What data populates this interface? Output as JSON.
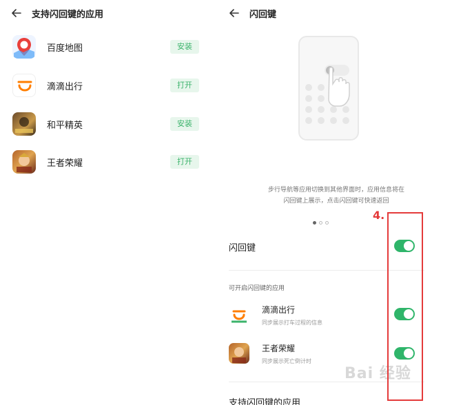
{
  "left": {
    "title": "支持闪回键的应用",
    "apps": [
      {
        "name": "百度地图",
        "action": "安装",
        "icon": "baidu-map-icon"
      },
      {
        "name": "滴滴出行",
        "action": "打开",
        "icon": "didi-icon"
      },
      {
        "name": "和平精英",
        "action": "安装",
        "icon": "peace-elite-icon"
      },
      {
        "name": "王者荣耀",
        "action": "打开",
        "icon": "honor-of-kings-icon"
      }
    ]
  },
  "right": {
    "title": "闪回键",
    "description_line1": "步行导航等应用切换到其他界面时，应用信息将在",
    "description_line2": "闪回键上展示，点击闪回键可快速返回",
    "main_toggle_label": "闪回键",
    "main_toggle_on": true,
    "section_title": "可开启闪回键的应用",
    "apps": [
      {
        "name": "滴滴出行",
        "desc": "同步展示打车过程的信息",
        "on": true
      },
      {
        "name": "王者荣耀",
        "desc": "同步展示死亡倒计时",
        "on": true
      }
    ],
    "bottom_label": "支持闪回键的应用",
    "annotation": "4.",
    "watermark": "Bai 经验"
  },
  "colors": {
    "accent": "#2fb56a",
    "pill_bg": "#e7f6ec",
    "annotation": "#e43a3a"
  }
}
